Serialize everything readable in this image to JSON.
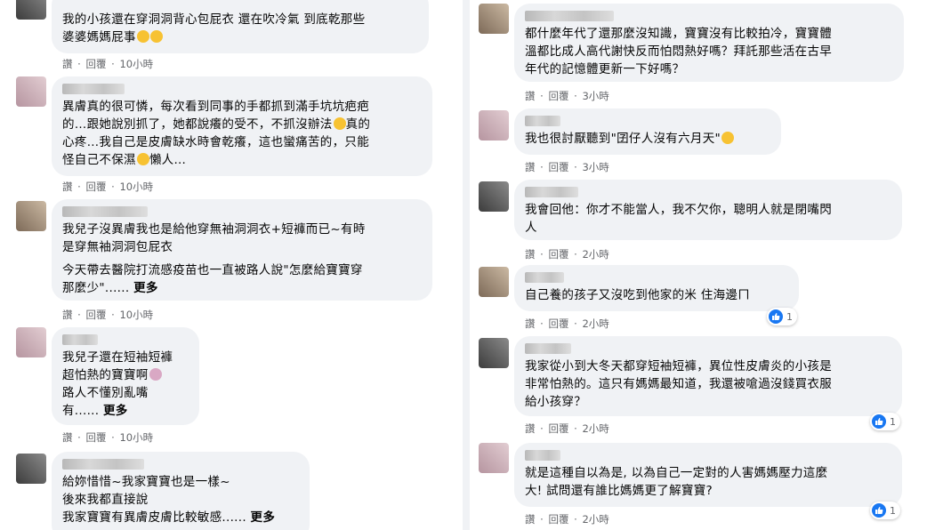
{
  "left_comments": [
    {
      "text": "我的小孩還在穿洞洞背心包屁衣 還在吹冷氣 到底乾那些\n婆婆媽媽屁事",
      "emoji_count": 2,
      "actions": {
        "like": "讚",
        "reply": "回覆",
        "time": "10小時"
      }
    },
    {
      "text": "異膚真的很可憐，每次看到同事的手都抓到滿手坑坑疤疤\n的…跟她說別抓了，她都說癢的受不，不抓沒辦法",
      "text_b": "真的\n心疼…我自己是皮膚缺水時會乾癢，這也蠻痛苦的，只能\n怪自己不保濕",
      "text_c": "懶人…",
      "actions": {
        "like": "讚",
        "reply": "回覆",
        "time": "10小時"
      }
    },
    {
      "text": "我兒子沒異膚我也是給他穿無袖洞洞衣+短褲而已~有時\n是穿無袖洞洞包屁衣",
      "text2": "今天帶去醫院打流感疫苗也一直被路人說\"怎麼給寶寶穿\n那麼少\"......",
      "more": "更多",
      "actions": {
        "like": "讚",
        "reply": "回覆",
        "time": "10小時"
      }
    },
    {
      "text": "我兒子還在短袖短褲\n超怕熱的寶寶啊",
      "text_b": "路人不懂別亂嘴\n有......",
      "more": "更多",
      "actions": {
        "like": "讚",
        "reply": "回覆",
        "time": "10小時"
      }
    },
    {
      "text": "給妳惜惜~我家寶寶也是一樣~\n後來我都直接說\n我家寶寶有異膚皮膚比較敏感......",
      "more": "更多",
      "actions": {}
    }
  ],
  "right_comments": [
    {
      "text": "都什麼年代了還那麼沒知識，寶寶沒有比較拍冷，寶寶體\n溫都比成人高代謝快反而怕悶熱好嗎？拜託那些活在古早\n年代的記憶體更新一下好嗎？",
      "actions": {
        "like": "讚",
        "reply": "回覆",
        "time": "3小時"
      }
    },
    {
      "text": "我也很討厭聽到\"囝仔人沒有六月天\"",
      "actions": {
        "like": "讚",
        "reply": "回覆",
        "time": "3小時"
      }
    },
    {
      "text": "我會回他：你才不能當人，我不欠你，聰明人就是閉嘴閃\n人",
      "actions": {
        "like": "讚",
        "reply": "回覆",
        "time": "2小時"
      }
    },
    {
      "text": "自己養的孩子又沒吃到他家的米 住海邊ㄇ",
      "reactions": "1",
      "actions": {
        "like": "讚",
        "reply": "回覆",
        "time": "2小時"
      }
    },
    {
      "text": "我家從小到大冬天都穿短袖短褲，異位性皮膚炎的小孩是\n非常怕熱的。這只有媽媽最知道，我還被嗆過沒錢買衣服\n給小孩穿？",
      "reactions": "1",
      "actions": {
        "like": "讚",
        "reply": "回覆",
        "time": "2小時"
      }
    },
    {
      "text": "就是這種自以為是, 以為自己一定對的人害媽媽壓力這麼\n大! 試問還有誰比媽媽更了解寶寶?",
      "reactions": "1",
      "actions": {
        "like": "讚",
        "reply": "回覆",
        "time": "2小時"
      }
    }
  ],
  "colors": {
    "bubble": "#f0f2f5",
    "meta": "#65676b",
    "like_blue": "#1877f2",
    "emoji": "#f7c232"
  }
}
